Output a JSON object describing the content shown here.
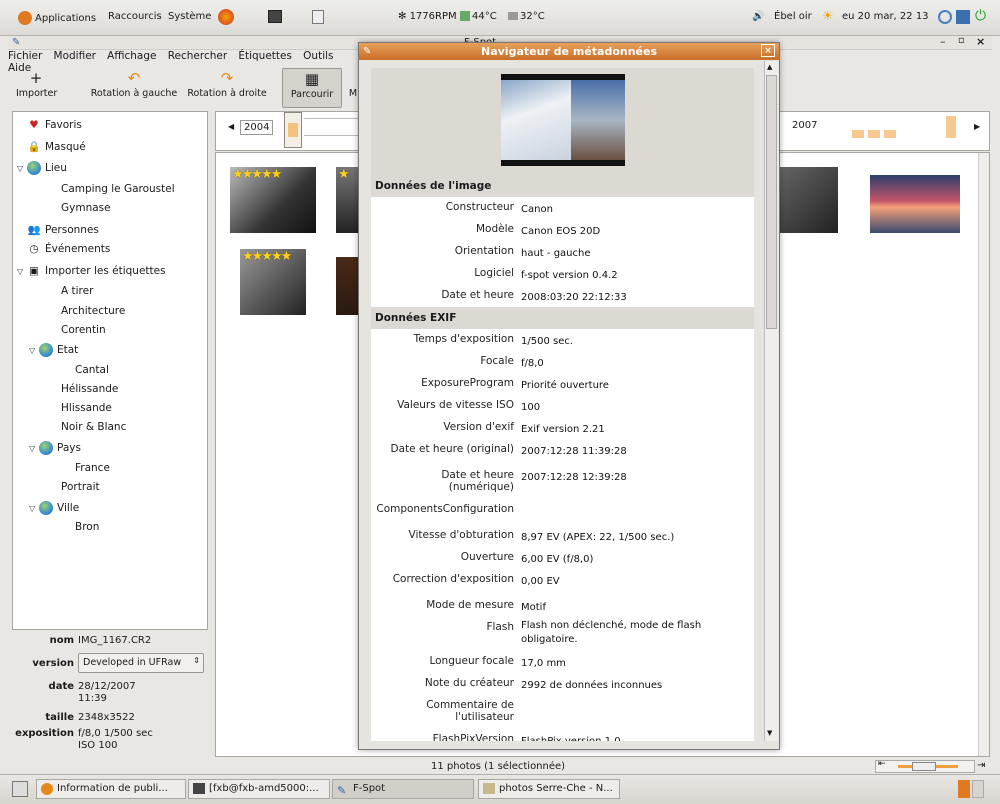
{
  "topbar": {
    "applications": "Applications",
    "shortcuts": "Raccourcis",
    "system": "Système",
    "cpu": "1776RPM",
    "temp1": "44°C",
    "temp2": "32°C",
    "user": "Ébel oir",
    "datetime": "eu 20 mar, 22 13"
  },
  "window": {
    "title": "F-Spot"
  },
  "menu": [
    "Fichier",
    "Modifier",
    "Affichage",
    "Rechercher",
    "Étiquettes",
    "Outils",
    "Aide"
  ],
  "toolbar": {
    "import": "Importer",
    "rot_left": "Rotation à gauche",
    "rot_right": "Rotation à droite",
    "browse": "Parcourir",
    "m": "M"
  },
  "sidebar": {
    "items": [
      {
        "label": "Favoris",
        "level": 0
      },
      {
        "label": "Masqué",
        "level": 0
      },
      {
        "label": "Lieu",
        "level": 0
      },
      {
        "label": "Camping le Garoustel",
        "level": 1
      },
      {
        "label": "Gymnase",
        "level": 1
      },
      {
        "label": "Personnes",
        "level": 0
      },
      {
        "label": "Événements",
        "level": 0
      },
      {
        "label": "Importer les étiquettes",
        "level": 0
      },
      {
        "label": "A tirer",
        "level": 1
      },
      {
        "label": "Architecture",
        "level": 1
      },
      {
        "label": "Corentin",
        "level": 1
      },
      {
        "label": "Etat",
        "level": 1
      },
      {
        "label": "Cantal",
        "level": 2
      },
      {
        "label": "Hélissande",
        "level": 1
      },
      {
        "label": "Hlissande",
        "level": 1
      },
      {
        "label": "Noir & Blanc",
        "level": 1
      },
      {
        "label": "Pays",
        "level": 1
      },
      {
        "label": "France",
        "level": 2
      },
      {
        "label": "Portrait",
        "level": 1
      },
      {
        "label": "Ville",
        "level": 1
      },
      {
        "label": "Bron",
        "level": 2
      }
    ]
  },
  "info": {
    "name_k": "nom",
    "name_v": "IMG_1167.CR2",
    "version_k": "version",
    "version_v": "Developed in UFRaw",
    "date_k": "date",
    "date_v1": "28/12/2007",
    "date_v2": "11:39",
    "size_k": "taille",
    "size_v": "2348x3522",
    "expo_k": "exposition",
    "expo_v1": "f/8,0 1/500 sec",
    "expo_v2": "ISO 100"
  },
  "timeline": {
    "year1": "2004",
    "year2": "2007"
  },
  "status": {
    "text": "11 photos (1 sélectionnée)"
  },
  "dialog": {
    "title": "Navigateur de métadonnées",
    "section1": "Données de l'image",
    "image_rows": [
      [
        "Constructeur",
        "Canon"
      ],
      [
        "Modèle",
        "Canon EOS 20D"
      ],
      [
        "Orientation",
        "haut - gauche"
      ],
      [
        "Logiciel",
        "f-spot version 0.4.2"
      ],
      [
        "Date et heure",
        "2008:03:20 22:12:33"
      ]
    ],
    "section2": "Données EXIF",
    "exif_rows": [
      [
        "Temps d'exposition",
        "1/500 sec."
      ],
      [
        "Focale",
        "f/8,0"
      ],
      [
        "ExposureProgram",
        "Priorité ouverture"
      ],
      [
        "Valeurs de vitesse ISO",
        "100"
      ],
      [
        "Version d'exif",
        "Exif version 2.21"
      ],
      [
        "Date et heure (original)",
        "2007:12:28 11:39:28"
      ],
      [
        "Date et heure (numérique)",
        "2007:12:28 12:39:28"
      ],
      [
        "ComponentsConfiguration",
        ""
      ],
      [
        "Vitesse d'obturation",
        "8,97 EV (APEX: 22, 1/500 sec.)"
      ],
      [
        "Ouverture",
        "6,00 EV (f/8,0)"
      ],
      [
        "Correction d'exposition",
        "0,00 EV"
      ],
      [
        "Mode de mesure",
        "Motif"
      ],
      [
        "Flash",
        "Flash non déclenché, mode de flash obligatoire."
      ],
      [
        "Longueur focale",
        "17,0 mm"
      ],
      [
        "Note du créateur",
        "2992 de données inconnues"
      ],
      [
        "Commentaire de l'utilisateur",
        ""
      ],
      [
        "FlashPixVersion",
        "FlashPix version 1.0"
      ]
    ]
  },
  "taskbar": [
    "Information de publi...",
    "[fxb@fxb-amd5000:...",
    "F-Spot",
    "photos Serre-Che - N..."
  ]
}
